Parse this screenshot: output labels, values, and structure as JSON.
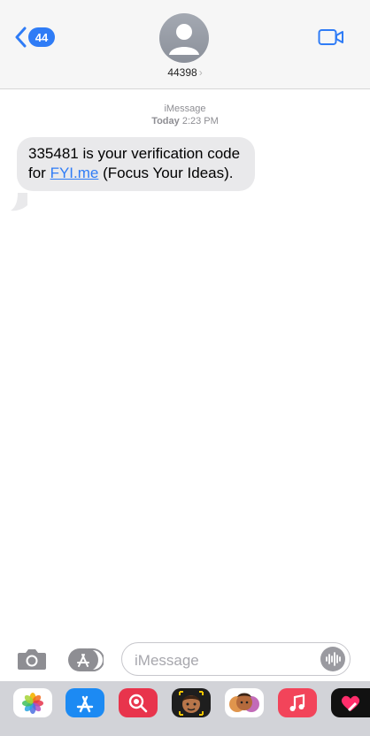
{
  "header": {
    "back_badge": "44",
    "contact_name": "44398",
    "icons": {
      "back": "chevron-left-icon",
      "avatar": "person-avatar-icon",
      "video": "video-camera-icon"
    }
  },
  "conversation": {
    "service": "iMessage",
    "day": "Today",
    "time": "2:23 PM",
    "message": {
      "before_link": "335481 is your verification code for ",
      "link_text": "FYI.me",
      "after_link": " (Focus Your Ideas)."
    }
  },
  "compose": {
    "placeholder": "iMessage",
    "icons": {
      "camera": "camera-icon",
      "apps": "app-store-icon",
      "audio": "waveform-icon"
    }
  },
  "app_drawer": {
    "apps": [
      "photos-app-icon",
      "app-store-app-icon",
      "search-images-app-icon",
      "memoji-app-icon",
      "animoji-app-icon",
      "music-app-icon",
      "digital-touch-app-icon"
    ]
  },
  "colors": {
    "accent": "#2f7cf6",
    "bubble": "#e9e9eb",
    "header": "#f6f6f6",
    "drawer": "#d2d3d8"
  }
}
